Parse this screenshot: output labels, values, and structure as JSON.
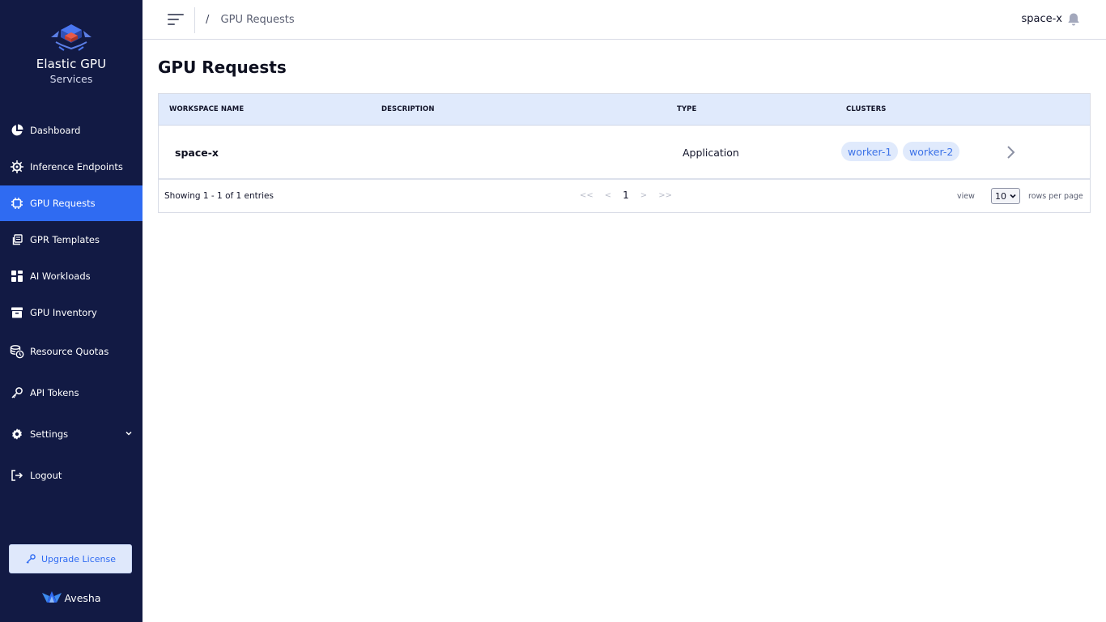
{
  "brand": {
    "title": "Elastic GPU",
    "subtitle": "Services"
  },
  "sidebar": {
    "items": [
      {
        "label": "Dashboard",
        "icon": "pie-chart-icon"
      },
      {
        "label": "Inference Endpoints",
        "icon": "gear-chip-icon"
      },
      {
        "label": "GPU Requests",
        "icon": "chip-icon",
        "active": true
      },
      {
        "label": "GPR Templates",
        "icon": "copy-icon"
      },
      {
        "label": "AI Workloads",
        "icon": "widgets-icon"
      },
      {
        "label": "GPU Inventory",
        "icon": "archive-icon"
      },
      {
        "label": "Resource Quotas",
        "icon": "coins-clock-icon"
      },
      {
        "label": "API Tokens",
        "icon": "key-icon"
      },
      {
        "label": "Settings",
        "icon": "settings-icon"
      },
      {
        "label": "Logout",
        "icon": "logout-icon"
      }
    ],
    "upgrade_label": "Upgrade License",
    "footer_brand": "Avesha"
  },
  "header": {
    "breadcrumb_sep": "/",
    "breadcrumb": "GPU Requests",
    "user": "space-x"
  },
  "main": {
    "title": "GPU Requests",
    "columns": [
      "WORKSPACE NAME",
      "DESCRIPTION",
      "TYPE",
      "CLUSTERS"
    ],
    "rows": [
      {
        "workspace": "space-x",
        "description": "",
        "type": "Application",
        "clusters": [
          "worker-1",
          "worker-2"
        ]
      }
    ],
    "footer": {
      "showing": "Showing 1 - 1 of 1 entries",
      "pager": {
        "first": "<<",
        "prev": "<",
        "current": "1",
        "next": ">",
        "last": ">>"
      },
      "view_label": "view",
      "rows_per_page": "10",
      "rows_label": "rows per page"
    }
  },
  "colors": {
    "sidebar": "#121a44",
    "accent": "#2f6bf2",
    "header_row": "#e0eafc"
  }
}
